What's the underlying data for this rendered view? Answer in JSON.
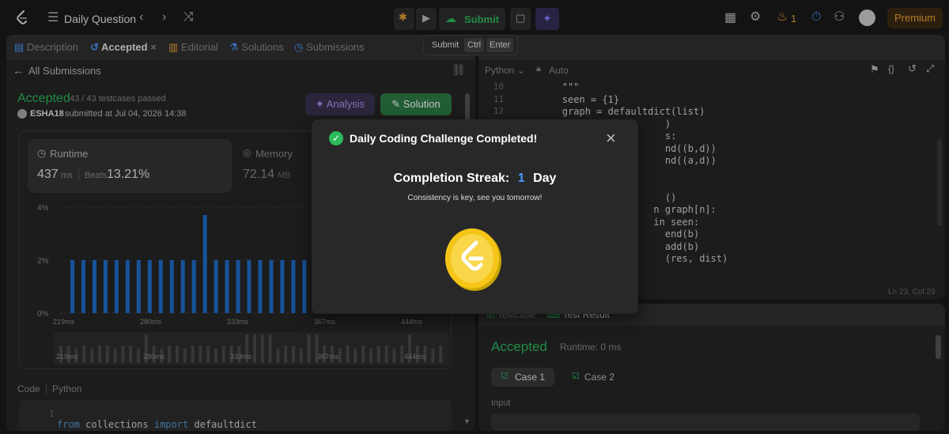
{
  "topbar": {
    "problem_list_label": "Daily Question",
    "submit_label": "Submit",
    "streak_count": "1",
    "premium_label": "Premium"
  },
  "tooltip": {
    "label": "Submit",
    "key1": "Ctrl",
    "key2": "Enter"
  },
  "left_tabs": {
    "description": "Description",
    "accepted": "Accepted",
    "editorial": "Editorial",
    "solutions": "Solutions",
    "submissions": "Submissions"
  },
  "submission": {
    "back_label": "All Submissions",
    "status": "Accepted",
    "testcases": "43 / 43 testcases passed",
    "user": "ESHA18",
    "submitted_at": "submitted at Jul 04, 2026 14:38",
    "analysis_label": "Analysis",
    "solution_label": "Solution"
  },
  "runtime": {
    "label": "Runtime",
    "value": "437",
    "unit": "ms",
    "beats_label": "Beats",
    "beats_value": "13.21%"
  },
  "memory": {
    "label": "Memory",
    "value": "72.14",
    "unit": "MB"
  },
  "chart_data": {
    "type": "bar",
    "ytick_labels": [
      "4%",
      "2%",
      "0%"
    ],
    "xtick_labels": [
      "219ms",
      "280ms",
      "333ms",
      "367ms",
      "444ms"
    ],
    "ylim": [
      0,
      4
    ],
    "values": [
      2,
      2,
      2,
      2,
      2,
      2,
      2,
      2,
      2,
      2,
      2,
      2,
      3.7,
      2,
      2,
      2,
      2,
      2,
      2,
      2,
      2,
      2,
      2,
      2,
      2,
      2,
      2,
      2,
      2,
      2,
      3.7,
      3.7,
      3.7,
      3.7
    ],
    "mini_values": [
      0.6,
      0.6,
      0.5,
      0.6,
      0.5,
      0.6,
      0.6,
      0.5,
      0.6,
      0.6,
      0.5,
      1,
      0.6,
      0.5,
      0.6,
      0.6,
      0.5,
      0.6,
      0.6,
      0.6,
      0.5,
      0.6,
      0.6,
      0.6,
      1,
      1,
      1,
      1,
      0.5,
      0.6,
      0.6,
      0.5,
      1,
      1,
      0.6,
      0.6,
      0.5,
      0.6,
      0.5,
      0.6,
      0.5,
      0.6,
      0.6,
      0.5,
      0.6,
      1,
      0.6,
      0.6,
      0.5,
      0.6
    ]
  },
  "code_panel": {
    "code_label": "Code",
    "lang_label": "Python",
    "line1_num": "1",
    "line1_kw1": "from",
    "line1_mod": "collections",
    "line1_kw2": "import",
    "line1_name": "defaultdict"
  },
  "editor": {
    "lang": "Python",
    "mode": "Auto",
    "status": "Ln 23, Col 29",
    "lines": [
      {
        "num": "10",
        "text": "        \"\"\""
      },
      {
        "num": "11",
        "text": "        seen = {1}"
      },
      {
        "num": "12",
        "text": "        graph = defaultdict(list)"
      },
      {
        "num": "13",
        "text": "                          )"
      },
      {
        "num": "14",
        "text": "                          s:"
      },
      {
        "num": "15",
        "text": "                          nd((b,d))"
      },
      {
        "num": "16",
        "text": "                          nd((a,d))"
      },
      {
        "num": "17",
        "text": ""
      },
      {
        "num": "18",
        "text": ""
      },
      {
        "num": "19",
        "text": "                          ()"
      },
      {
        "num": "20",
        "text": "                        n graph[n]:"
      },
      {
        "num": "21",
        "text": "                        in seen:"
      },
      {
        "num": "22",
        "text": "                          end(b)"
      },
      {
        "num": "23",
        "text": "                          add(b)"
      },
      {
        "num": "24",
        "text": "                          (res, dist)"
      }
    ]
  },
  "result": {
    "tab_testcase": "Testcase",
    "tab_result": "Test Result",
    "status": "Accepted",
    "runtime": "Runtime: 0 ms",
    "case1": "Case 1",
    "case2": "Case 2",
    "input_label": "Input"
  },
  "modal": {
    "title": "Daily Coding Challenge Completed!",
    "streak_label": "Completion Streak:",
    "streak_value": "1",
    "streak_unit": "Day",
    "message": "Consistency is key, see you tomorrow!"
  },
  "colors": {
    "accent_green": "#2cbb5d",
    "bar_blue": "#1f6fd0",
    "brand_orange": "#f2a33a"
  }
}
